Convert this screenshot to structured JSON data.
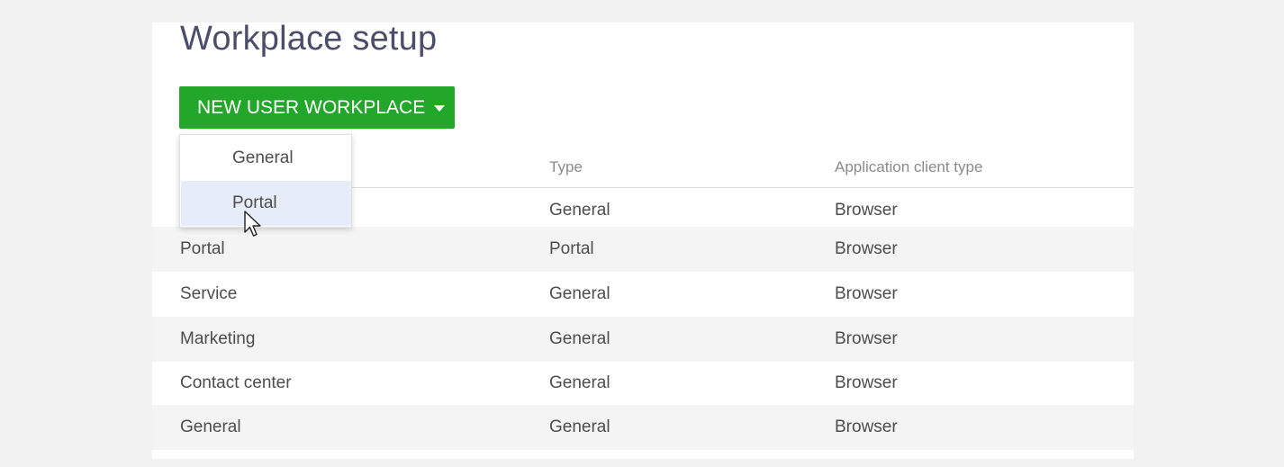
{
  "page": {
    "title": "Workplace setup"
  },
  "toolbar": {
    "new_button_label": "NEW USER WORKPLACE",
    "accent_color": "#22a72a"
  },
  "dropdown": {
    "items": [
      {
        "label": "General",
        "hovered": false
      },
      {
        "label": "Portal",
        "hovered": true
      }
    ]
  },
  "table": {
    "columns": [
      "Type",
      "Application client type"
    ],
    "rows": [
      {
        "name": "",
        "type": "General",
        "client": "Browser"
      },
      {
        "name": "Portal",
        "type": "Portal",
        "client": "Browser"
      },
      {
        "name": "Service",
        "type": "General",
        "client": "Browser"
      },
      {
        "name": "Marketing",
        "type": "General",
        "client": "Browser"
      },
      {
        "name": "Contact center",
        "type": "General",
        "client": "Browser"
      },
      {
        "name": "General",
        "type": "General",
        "client": "Browser"
      }
    ]
  },
  "cursor": {
    "icon": "mouse-pointer-icon"
  }
}
